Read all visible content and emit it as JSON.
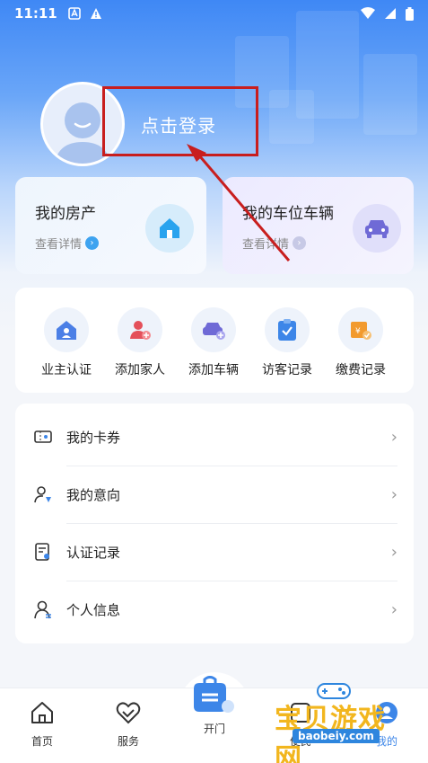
{
  "status": {
    "time": "11:11"
  },
  "login": {
    "text": "点击登录"
  },
  "cards": {
    "property": {
      "title": "我的房产",
      "sub": "查看详情"
    },
    "vehicle": {
      "title": "我的车位车辆",
      "sub": "查看详情"
    }
  },
  "actions": [
    {
      "label": "业主认证",
      "icon": "owner-verify-icon"
    },
    {
      "label": "添加家人",
      "icon": "add-family-icon"
    },
    {
      "label": "添加车辆",
      "icon": "add-car-icon"
    },
    {
      "label": "访客记录",
      "icon": "visitor-record-icon"
    },
    {
      "label": "缴费记录",
      "icon": "payment-record-icon"
    }
  ],
  "menu": [
    {
      "label": "我的卡券",
      "icon": "coupon-icon"
    },
    {
      "label": "我的意向",
      "icon": "intention-icon"
    },
    {
      "label": "认证记录",
      "icon": "cert-record-icon"
    },
    {
      "label": "个人信息",
      "icon": "profile-icon"
    }
  ],
  "tabs": [
    {
      "label": "首页",
      "icon": "home-icon"
    },
    {
      "label": "服务",
      "icon": "service-icon"
    },
    {
      "label": "开门",
      "icon": "open-door-icon"
    },
    {
      "label": "便民",
      "icon": "convenience-icon"
    },
    {
      "label": "我的",
      "icon": "me-icon"
    }
  ],
  "watermark": {
    "text": "宝贝游戏网",
    "url": "baobeiy.com"
  },
  "colors": {
    "primary": "#3f88f5",
    "annotation": "#c81e1e"
  }
}
